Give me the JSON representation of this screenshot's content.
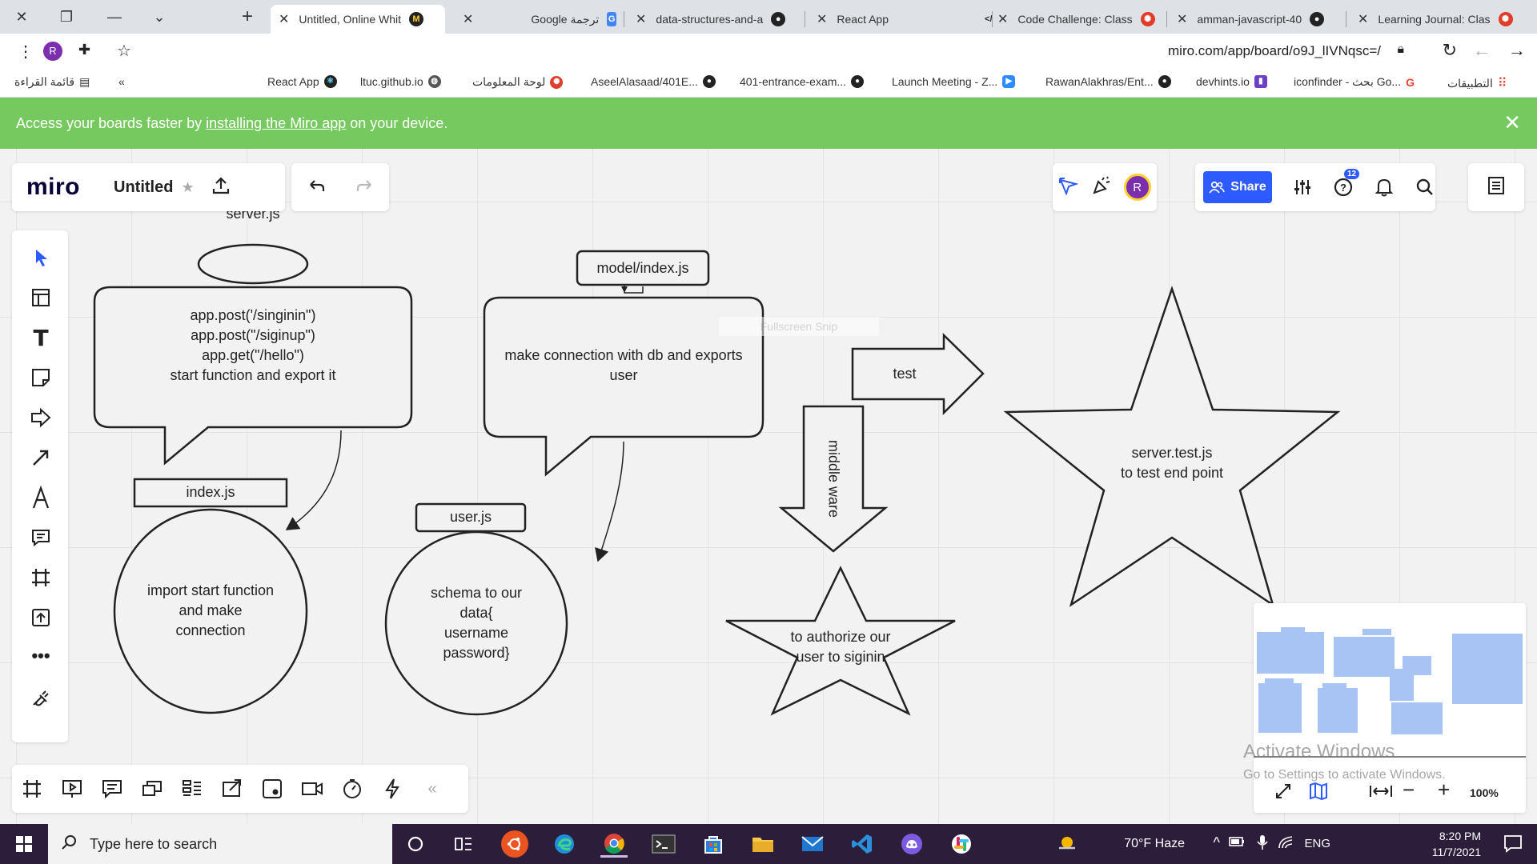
{
  "browser": {
    "tabs": [
      {
        "label": "Untitled, Online Whit",
        "icon": "miro-icon",
        "active": true
      },
      {
        "label": "Google ترجمة",
        "icon": "translate-icon"
      },
      {
        "label": "data-structures-and-a",
        "icon": "github-icon"
      },
      {
        "label": "React App",
        "icon": "code-icon"
      },
      {
        "label": "Code Challenge: Class",
        "icon": "canvas-icon"
      },
      {
        "label": "amman-javascript-40",
        "icon": "github-icon"
      },
      {
        "label": "Learning Journal: Clas",
        "icon": "canvas-icon"
      }
    ],
    "url": "miro.com/app/board/o9J_lIVNqsc=/",
    "bookmarks": [
      {
        "label": "قائمة القراءة"
      },
      {
        "label": "React App"
      },
      {
        "label": "ltuc.github.io"
      },
      {
        "label": "لوحة المعلومات"
      },
      {
        "label": "AseelAlasaad/401E..."
      },
      {
        "label": "401-entrance-exam..."
      },
      {
        "label": "Launch Meeting - Z..."
      },
      {
        "label": "RawanAlakhras/Ent..."
      },
      {
        "label": "devhints.io"
      },
      {
        "label": "iconfinder - بحث Go..."
      },
      {
        "label": "التطبيقات"
      }
    ]
  },
  "banner": {
    "prefix": "Access your boards faster by",
    "link": "installing the Miro app",
    "suffix": "on your device."
  },
  "miro": {
    "logo": "miro",
    "board_title": "Untitled",
    "share_label": "Share",
    "avatar_initial": "R",
    "help_badge": "12",
    "zoom": "100%",
    "snip_overlay": "Fullscreen Snip"
  },
  "shapes": {
    "server_js": "server.js",
    "server_callout": [
      "app.post('/singinin\")",
      "app.post(\"/siginup\")",
      "app.get(\"/hello\")",
      "start function and export it"
    ],
    "index_js": "index.js",
    "index_circle": [
      "import start function",
      "and make",
      "connection"
    ],
    "model_index": "model/index.js",
    "model_callout": [
      "make connection with db and exports",
      "user"
    ],
    "user_js": "user.js",
    "user_circle": [
      "schema to our",
      "data{",
      "username",
      "password}"
    ],
    "test_arrow": "test",
    "middleware_arrow": "middle ware",
    "authorize_star": [
      "to authorize our",
      "user to siginin"
    ],
    "server_test_star": [
      "server.test.js",
      "to test end point"
    ]
  },
  "windows_watermark": {
    "line1": "Activate Windows",
    "line2": "Go to Settings to activate Windows."
  },
  "taskbar": {
    "search_placeholder": "Type here to search",
    "weather": "70°F  Haze",
    "language": "ENG",
    "time": "8:20 PM",
    "date": "11/7/2021"
  }
}
